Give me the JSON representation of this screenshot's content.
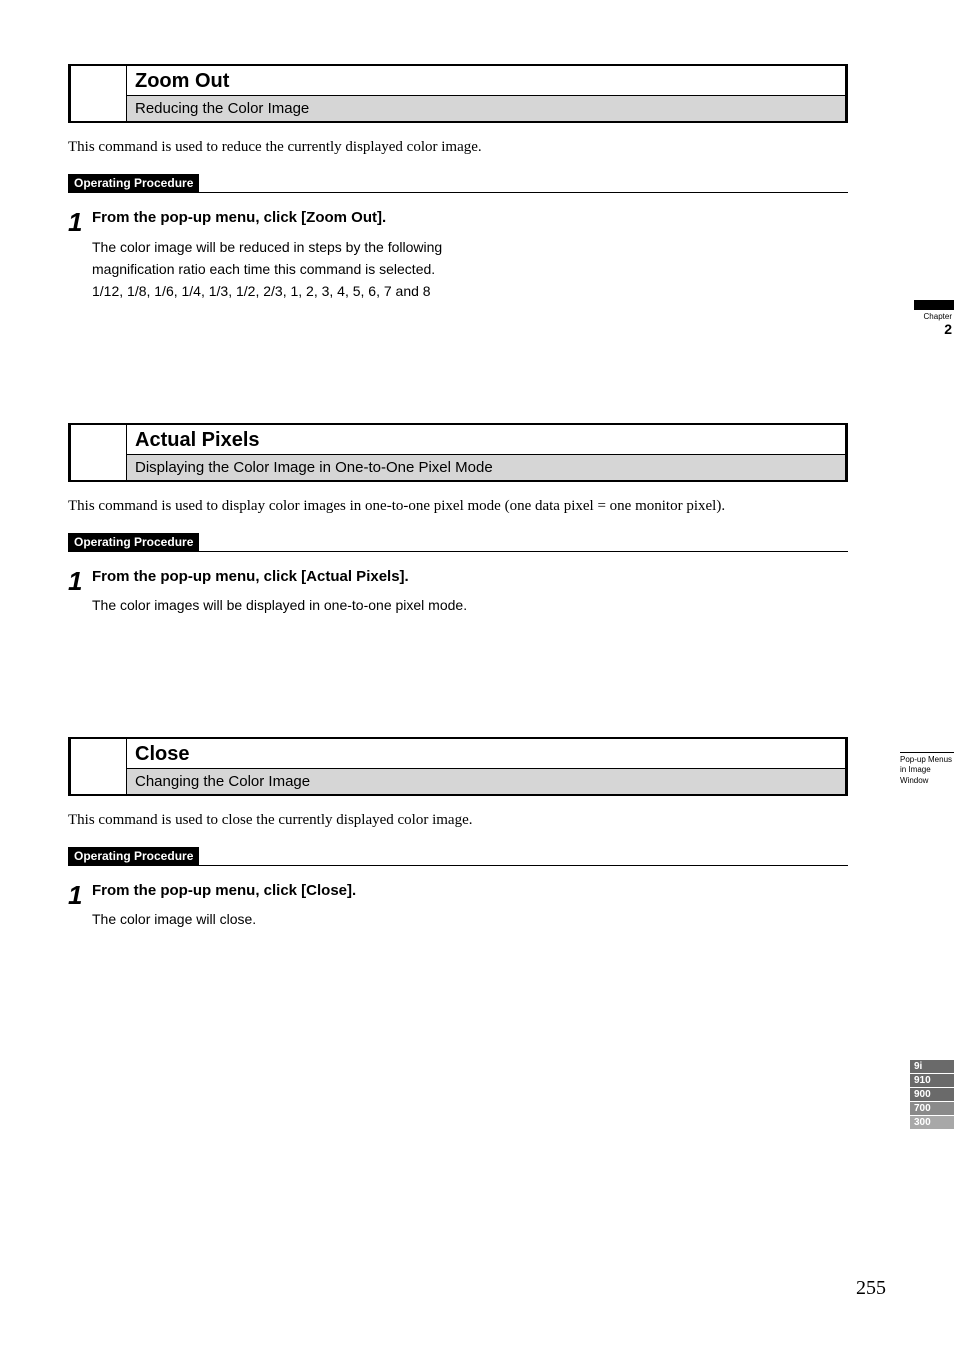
{
  "sections": [
    {
      "title": "Zoom Out",
      "subtitle": "Reducing the Color Image",
      "description": "This command is used to reduce the currently displayed color image.",
      "op_label": "Operating Procedure",
      "step_num": "1",
      "step_head": "From the pop-up menu, click [Zoom Out].",
      "step_text": "The color image will be reduced in steps by the following magnification ratio each time this command is selected.\n1/12, 1/8, 1/6, 1/4, 1/3, 1/2, 2/3, 1, 2, 3, 4, 5, 6, 7 and 8"
    },
    {
      "title": "Actual Pixels",
      "subtitle": "Displaying the Color Image in One-to-One Pixel Mode",
      "description": "This command is used to display color images in one-to-one pixel mode (one data pixel = one monitor pixel).",
      "op_label": "Operating Procedure",
      "step_num": "1",
      "step_head": "From the pop-up menu, click [Actual Pixels].",
      "step_text": "The color images will be displayed in one-to-one pixel mode."
    },
    {
      "title": "Close",
      "subtitle": "Changing the Color Image",
      "description": "This command is used to close the currently displayed color image.",
      "op_label": "Operating Procedure",
      "step_num": "1",
      "step_head": "From the pop-up menu, click [Close].",
      "step_text": "The color image will close."
    }
  ],
  "chapter_tab": {
    "prefix": "Chapter",
    "num": "2"
  },
  "section_tab": "Pop-up Menus in Image Window",
  "models": [
    "9i",
    "910",
    "900",
    "700",
    "300"
  ],
  "page_number": "255"
}
